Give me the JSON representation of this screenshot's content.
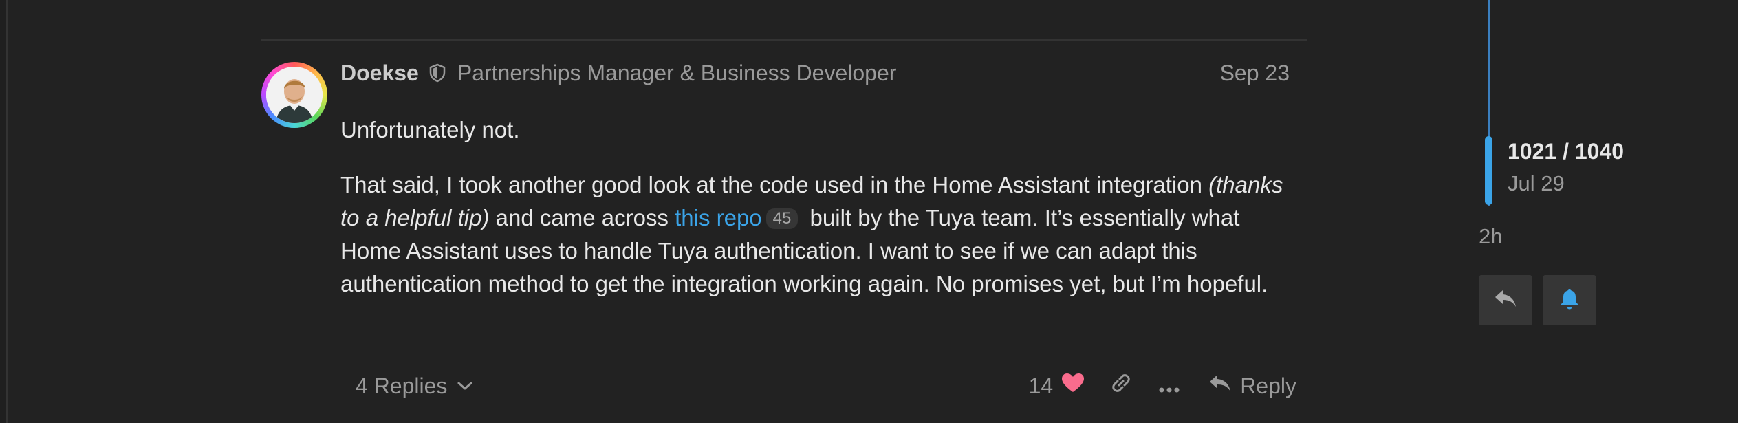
{
  "post": {
    "username": "Doekse",
    "user_title": "Partnerships Manager & Business Developer",
    "date": "Sep 23",
    "paragraph1": "Unfortunately not.",
    "p2_part1": "That said, I took another good look at the code used in the Home Assistant integration ",
    "p2_italic": "(thanks to a helpful tip)",
    "p2_part2": " and came across ",
    "p2_link": "this repo",
    "p2_link_clicks": "45",
    "p2_part3": " built by the Tuya team. It’s essentially what Home Assistant uses to handle Tuya authentication. I want to see if we can adapt this authentication method to get the integration working again. No promises yet, but I’m hopeful."
  },
  "controls": {
    "replies_label": "4 Replies",
    "like_count": "14",
    "reply_label": "Reply"
  },
  "timeline": {
    "position": "1021 / 1040",
    "date": "Jul 29",
    "ago": "2h"
  },
  "icons": {
    "shield": "shield-icon",
    "heart": "heart-icon",
    "link": "link-icon",
    "more": "ellipsis-icon",
    "reply": "reply-icon",
    "bell": "bell-icon",
    "chevron": "chevron-down-icon"
  },
  "colors": {
    "background": "#222222",
    "link": "#3ba4e8",
    "heart": "#fa6c8d",
    "timeline": "#3ba4e8"
  }
}
